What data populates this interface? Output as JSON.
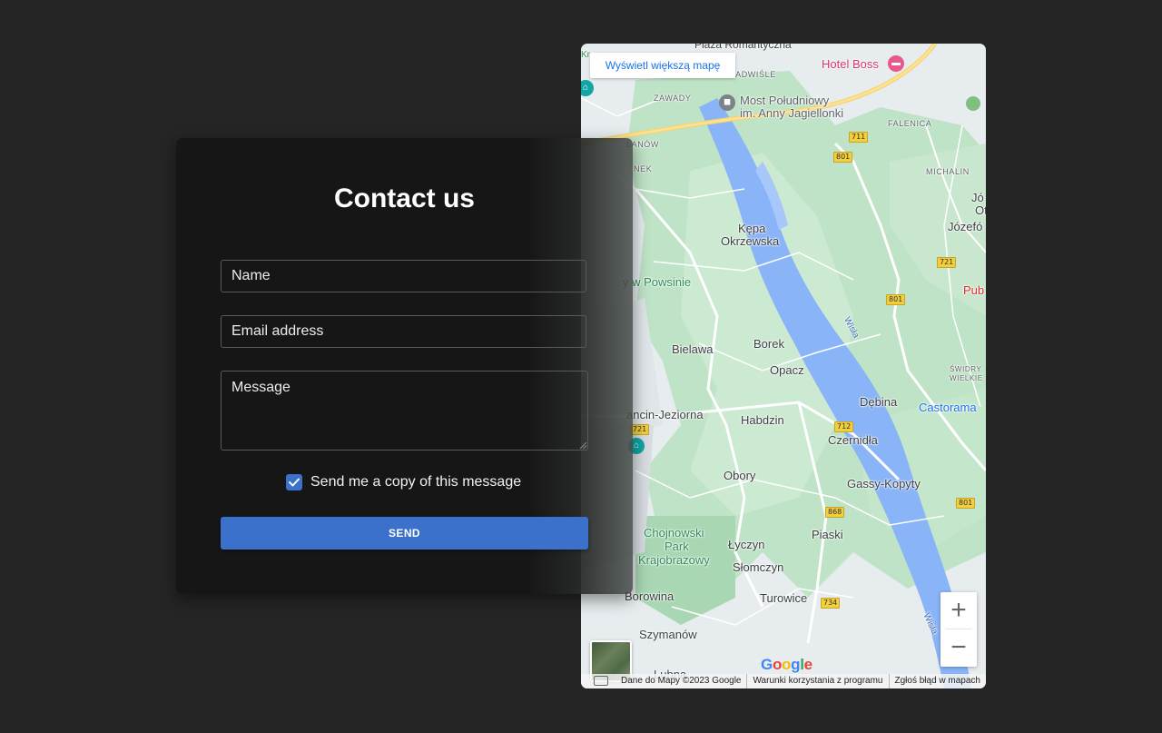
{
  "form": {
    "title": "Contact us",
    "name_placeholder": "Name",
    "email_placeholder": "Email address",
    "message_placeholder": "Message",
    "copy_checkbox_label": "Send me a copy of this message",
    "copy_checked": true,
    "send_label": "SEND",
    "accent_color": "#3b71ca"
  },
  "map": {
    "bigger_map_link": "Wyświetl większą mapę",
    "zoom_in": "+",
    "zoom_out": "−",
    "google_logo": [
      "G",
      "o",
      "o",
      "g",
      "l",
      "e"
    ],
    "attribution": {
      "data": "Dane do Mapy ©2023 Google",
      "terms": "Warunki korzystania z programu",
      "report": "Zgłoś błąd w mapach"
    },
    "places": {
      "plaza": "Plaza Romantyczna",
      "nadwisle": "NADWIŚLE",
      "zawady": "ZAWADY",
      "hotel": "Hotel Boss",
      "bridge_1": "Most Południowy",
      "bridge_2": "im. Anny Jagiellonki",
      "falenica": "FALENICA",
      "wilanow": "LANÓW",
      "nek": "NEK",
      "michalin": "MICHALIN",
      "jo": "Jó",
      "ot": "Ot",
      "jozefow": "Józefó",
      "kepa_1": "Kępa",
      "kepa_2": "Okrzewska",
      "powsinie": "y w Powsinie",
      "pub": "Pub",
      "bielawa": "Bielawa",
      "borek": "Borek",
      "opacz": "Opacz",
      "swidry_1": "ŚWIDRY",
      "swidry_2": "WIELKIE",
      "debina": "Dębina",
      "castorama": "Castorama",
      "konstancin": "ancin-Jeziorna",
      "habdzin": "Habdzin",
      "czernidla": "Czernidła",
      "obory": "Obory",
      "gassy": "Gassy-Kopyty",
      "chojnowski_1": "Chojnowski",
      "chojnowski_2": "Park",
      "chojnowski_3": "Krajobrazowy",
      "piaski": "Piaski",
      "lyczyn": "Łyczyn",
      "slomczyn": "Słomczyn",
      "borowina": "Borowina",
      "turowice": "Turowice",
      "szymanow": "Szymanów",
      "lubna": "Lubna",
      "kr": "Kr",
      "wisla": "Wisła"
    },
    "roads": [
      "711",
      "801",
      "721",
      "801",
      "721",
      "712",
      "868",
      "801",
      "734"
    ]
  }
}
